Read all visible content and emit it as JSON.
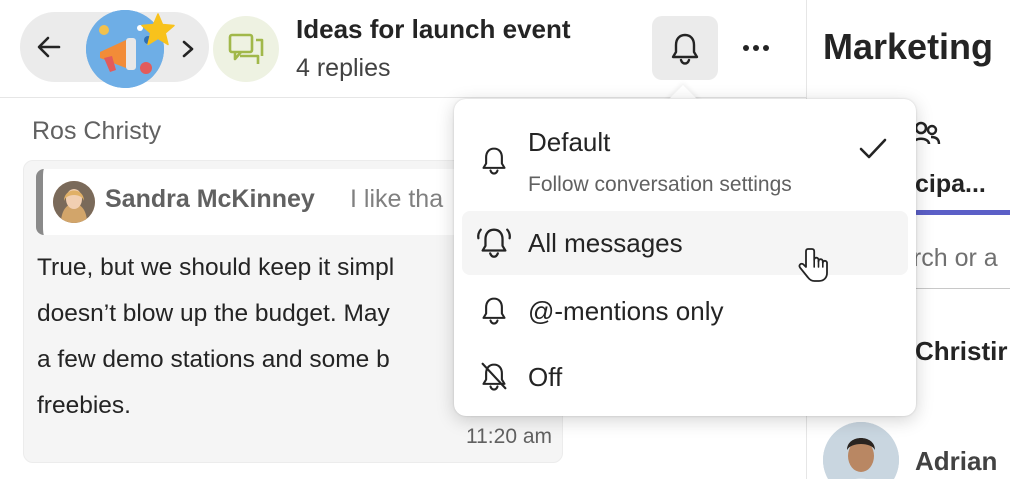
{
  "header": {
    "title": "Ideas for launch event",
    "subtitle": "4 replies"
  },
  "message": {
    "author": "Ros Christy",
    "quote_author": "Sandra McKinney",
    "quote_text": "I like tha",
    "body_lines": [
      "True, but we should keep it simpl",
      "doesn’t blow up the budget. May",
      "a few demo stations and some b",
      "freebies."
    ],
    "time": "11:20 am"
  },
  "notification_menu": {
    "items": [
      {
        "label": "Default",
        "sublabel": "Follow conversation settings",
        "icon": "bell-icon",
        "selected": true
      },
      {
        "label": "All messages",
        "icon": "bell-ring-icon",
        "hovered": true
      },
      {
        "label": "@-mentions only",
        "icon": "bell-icon"
      },
      {
        "label": "Off",
        "icon": "bell-off-icon"
      }
    ]
  },
  "right_pane": {
    "channel_title": "Marketing",
    "tab_label": "cipa...",
    "search_placeholder": "arch or a",
    "members": [
      "Christir",
      "Adrian"
    ]
  },
  "colors": {
    "accent": "#5b5fc7",
    "pill_bg": "#ebebeb",
    "card_bg": "#f5f5f5"
  }
}
